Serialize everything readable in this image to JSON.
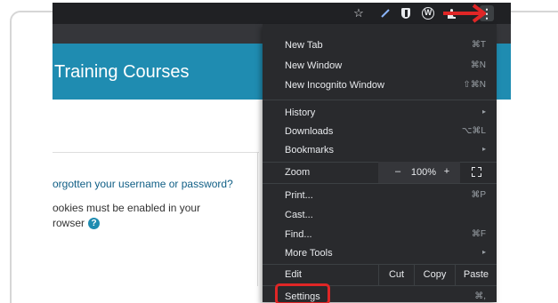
{
  "browser": {
    "toolbar_icons": [
      "star-icon",
      "pen-icon",
      "shield-icon",
      "w-extension-icon",
      "puzzle-icon",
      "more-vert-icon"
    ]
  },
  "page": {
    "banner_title": "Training Courses",
    "forgot_link": "orgotten your username or password?",
    "cookies_line1": "ookies must be enabled in your",
    "cookies_line2": "rowser",
    "help_glyph": "?"
  },
  "menu": {
    "group1": [
      {
        "label": "New Tab",
        "shortcut": "⌘T"
      },
      {
        "label": "New Window",
        "shortcut": "⌘N"
      },
      {
        "label": "New Incognito Window",
        "shortcut": "⇧⌘N"
      }
    ],
    "group2": [
      {
        "label": "History",
        "shortcut": "▸"
      },
      {
        "label": "Downloads",
        "shortcut": "⌥⌘L"
      },
      {
        "label": "Bookmarks",
        "shortcut": "▸"
      }
    ],
    "zoom": {
      "label": "Zoom",
      "minus": "–",
      "value": "100%",
      "plus": "+"
    },
    "group3": [
      {
        "label": "Print...",
        "shortcut": "⌘P"
      },
      {
        "label": "Cast...",
        "shortcut": ""
      },
      {
        "label": "Find...",
        "shortcut": "⌘F"
      },
      {
        "label": "More Tools",
        "shortcut": "▸"
      }
    ],
    "edit": {
      "label": "Edit",
      "cut": "Cut",
      "copy": "Copy",
      "paste": "Paste"
    },
    "settings": {
      "label": "Settings",
      "shortcut": "⌘,"
    }
  },
  "colors": {
    "banner": "#1f8cb1",
    "menu_bg": "#292a2d",
    "highlight": "#e02626"
  }
}
